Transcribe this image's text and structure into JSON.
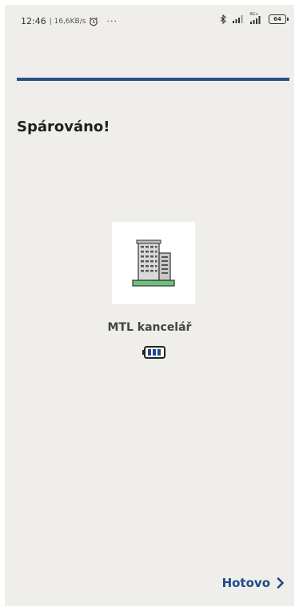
{
  "status_bar": {
    "time": "12:46",
    "network_speed": "16,6KB/s",
    "more_dots": "···",
    "network_type": "4G+",
    "battery_level": "64"
  },
  "page": {
    "title": "Spárováno!"
  },
  "device": {
    "name": "MTL kancelář",
    "icon": "office-building-icon",
    "battery_icon": "battery-full-icon"
  },
  "footer": {
    "done_label": "Hotovo",
    "done_icon": "chevron-right-icon"
  },
  "colors": {
    "accent": "#1d4a8a",
    "line": "#2a4f86",
    "background": "#efeeea"
  }
}
